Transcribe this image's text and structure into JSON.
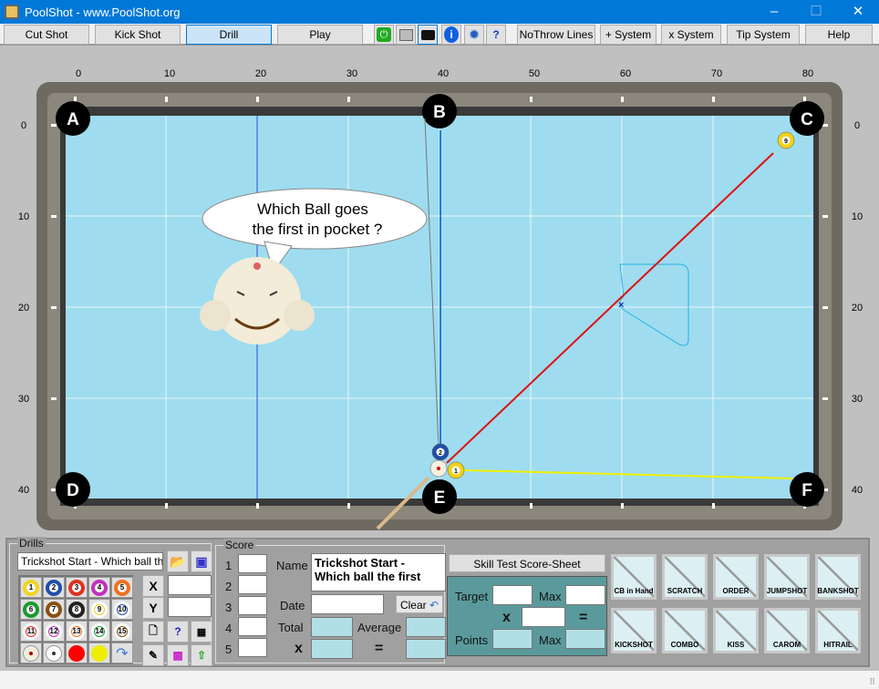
{
  "window": {
    "title": "PoolShot - www.PoolShot.org",
    "minimize": "–",
    "maximize": "☐",
    "close": "✕"
  },
  "toolbar": {
    "buttons": [
      "Cut Shot",
      "Kick Shot",
      "Drill",
      "Play"
    ],
    "active": "Drill",
    "icons": [
      "power-icon",
      "print-icon",
      "camera-icon",
      "info-icon",
      "settings-icon",
      "help-doc-icon"
    ],
    "right_buttons": [
      "NoThrow Lines",
      "+ System",
      "x System",
      "Tip System",
      "Help"
    ]
  },
  "table": {
    "x_ticks": [
      "0",
      "10",
      "20",
      "30",
      "40",
      "50",
      "60",
      "70",
      "80"
    ],
    "y_ticks": [
      "0",
      "10",
      "20",
      "30",
      "40"
    ],
    "pockets": [
      "A",
      "B",
      "C",
      "D",
      "E",
      "F"
    ],
    "felt_color": "#9fdcef",
    "balls": [
      {
        "id": "9",
        "x": 78,
        "y": 1.7,
        "color": "#f2d21b"
      },
      {
        "id": "2",
        "x": 40.1,
        "y": 35.9,
        "color": "#1f4fa8"
      },
      {
        "id": "1",
        "x": 41.8,
        "y": 37.9,
        "color": "#f2d21b"
      },
      {
        "id": "cue",
        "x": 39.9,
        "y": 37.7,
        "color": "#f4f0e0"
      }
    ],
    "lines": [
      {
        "from": [
          40.1,
          35.3
        ],
        "to": [
          40.1,
          0.6
        ],
        "color": "#1e7be0"
      },
      {
        "from": [
          40.8,
          37.1
        ],
        "to": [
          76.6,
          3.1
        ],
        "color": "#e01010"
      },
      {
        "from": [
          42.6,
          37.9
        ],
        "to": [
          78.8,
          38.8
        ],
        "color": "#f0f000"
      },
      {
        "from": [
          40,
          37.7
        ],
        "to": [
          38.4,
          -0.7
        ],
        "color": "#777777"
      }
    ],
    "speech": "Which Ball goes the first in pocket ?"
  },
  "drills": {
    "label": "Drills",
    "current": "Trickshot Start - Which ball the fi",
    "balls": [
      "1",
      "2",
      "3",
      "4",
      "5",
      "6",
      "7",
      "8",
      "9",
      "10",
      "11",
      "12",
      "13",
      "14",
      "15"
    ],
    "x_label": "X",
    "y_label": "Y",
    "x_value": "",
    "y_value": ""
  },
  "score": {
    "label": "Score",
    "rows": [
      "1",
      "2",
      "3",
      "4",
      "5"
    ],
    "name_label": "Name",
    "name_value": "Trickshot Start - Which ball the first",
    "date_label": "Date",
    "clear": "Clear",
    "total_label": "Total",
    "average_label": "Average",
    "x_label": "x",
    "eq_label": "="
  },
  "skill": {
    "title": "Skill Test Score-Sheet",
    "target": "Target",
    "max": "Max",
    "x": "x",
    "eq": "=",
    "points": "Points",
    "max2": "Max"
  },
  "shots": [
    "CB in Hand",
    "SCRATCH",
    "ORDER",
    "JUMPSHOT",
    "BANKSHOT",
    "KICKSHOT",
    "COMBO",
    "KISS",
    "CAROM",
    "HITRAIL"
  ]
}
